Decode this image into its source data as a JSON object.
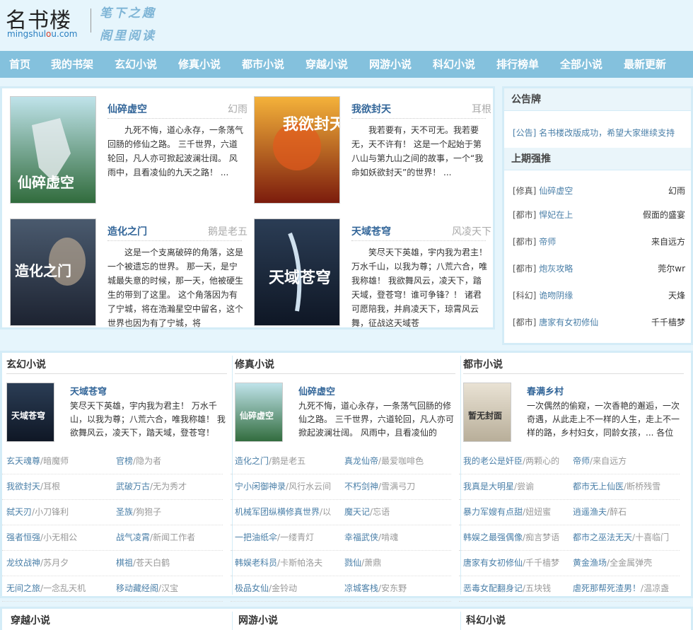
{
  "site": {
    "logo_text": "名书楼",
    "logo_url_prefix": "mingshul",
    "logo_url_mid": "o",
    "logo_url_mid2": "u",
    "logo_url_suffix": ".com",
    "slogan_line1": "笔下之趣",
    "slogan_line2": "阁里阅读"
  },
  "nav": [
    "首页",
    "我的书架",
    "玄幻小说",
    "修真小说",
    "都市小说",
    "穿越小说",
    "网游小说",
    "科幻小说",
    "排行榜单",
    "全部小说",
    "最新更新"
  ],
  "featured": [
    {
      "title": "仙碎虚空",
      "author": "幻雨",
      "desc": "九死不悔，道心永存，一条荡气回肠的修仙之路。 三千世界，六道轮回，凡人亦可掀起波澜壮阔。 风雨中，且看凌仙的九天之路！ ...",
      "cover_label": "仙碎虚空"
    },
    {
      "title": "我欲封天",
      "author": "耳根",
      "desc": "我若要有，天不可无。我若要无，天不许有！ 这是一个起始于第八山与第九山之间的故事，一个“我命如妖欲封天”的世界！ ...",
      "cover_label": "我欲封天"
    },
    {
      "title": "造化之门",
      "author": "鹅是老五",
      "desc": "这是一个支离破碎的角落，这是一个被遗忘的世界。 那一天，是宁城最失意的时候，那一天，他被硬生生的带到了这里。 这个角落因为有了宁城，将在浩瀚星空中留名，这个世界也因为有了宁城，将",
      "cover_label": "造化之门"
    },
    {
      "title": "天域苍穹",
      "author": "风凌天下",
      "desc": "笑尽天下英雄，宇内我为君主！ 万水千山，以我为尊；八荒六合，唯我称雄！ 我欲舞风云，凌天下，踏天域，登苍穹！谁可争锋？！ 诸君可愿陪我，并肩凌天下，琼霄风云舞，征战这天域苍",
      "cover_label": "天域苍穹"
    }
  ],
  "sidebar": {
    "notice_heading": "公告牌",
    "notice_text": "[公告] 名书楼改版成功，希望大家继续支持",
    "rank_heading": "上期强推",
    "rank": [
      {
        "cat": "[修真]",
        "title": "仙碎虚空",
        "author": "幻雨"
      },
      {
        "cat": "[都市]",
        "title": "悍妃在上",
        "author": "假面的盛宴"
      },
      {
        "cat": "[都市]",
        "title": "帝师",
        "author": "来自远方"
      },
      {
        "cat": "[都市]",
        "title": "炮灰攻略",
        "author": "莞尔wr"
      },
      {
        "cat": "[科幻]",
        "title": "诡吻阴缘",
        "author": "天烽"
      },
      {
        "cat": "[都市]",
        "title": "唐家有女初修仙",
        "author": "千千樯梦"
      }
    ]
  },
  "categories": [
    {
      "heading": "玄幻小说",
      "top": {
        "title": "天域苍穹",
        "desc": "笑尽天下英雄，宇内我为君主！ 万水千山，以我为尊；八荒六合，唯我称雄！ 我欲舞风云，凌天下，踏天域，登苍穹！",
        "cover_label": "天域苍穹"
      },
      "items": [
        {
          "title": "玄天魂尊",
          "author": "暗魔师"
        },
        {
          "title": "官榜",
          "author": "隐为者"
        },
        {
          "title": "我欲封天",
          "author": "耳根"
        },
        {
          "title": "武破万古",
          "author": "无为秀才"
        },
        {
          "title": "弑天刃",
          "author": "小刀锋利"
        },
        {
          "title": "圣族",
          "author": "狗狍子"
        },
        {
          "title": "强者恒强",
          "author": "小无相公"
        },
        {
          "title": "战气凌霄",
          "author": "新闻工作者"
        },
        {
          "title": "龙纹战神",
          "author": "苏月夕"
        },
        {
          "title": "棋祖",
          "author": "苍天白鹤"
        },
        {
          "title": "无间之旅",
          "author": "一念乱天机"
        },
        {
          "title": "移动藏经阁",
          "author": "汉宝"
        }
      ]
    },
    {
      "heading": "修真小说",
      "top": {
        "title": "仙碎虚空",
        "desc": "九死不悔，道心永存，一条荡气回肠的修仙之路。 三千世界，六道轮回，凡人亦可掀起波澜壮阔。 风雨中，且看凌仙的",
        "cover_label": "仙碎虚空"
      },
      "items": [
        {
          "title": "造化之门",
          "author": "鹅是老五"
        },
        {
          "title": "真龙仙帝",
          "author": "最爱咖啡色"
        },
        {
          "title": "宁小闲御神录",
          "author": "风行水云间"
        },
        {
          "title": "不朽剑神",
          "author": "雪满弓刀"
        },
        {
          "title": "机械军团纵横修真世界",
          "author": "以"
        },
        {
          "title": "魔天记",
          "author": "忘语"
        },
        {
          "title": "一把油纸伞",
          "author": "一缕青灯"
        },
        {
          "title": "幸福武侠",
          "author": "啃魂"
        },
        {
          "title": "韩娱老科员",
          "author": "卡斯帕洛夫"
        },
        {
          "title": "戮仙",
          "author": "萧鼎"
        },
        {
          "title": "极品女仙",
          "author": "金铃动"
        },
        {
          "title": "凉城客栈",
          "author": "安东野"
        }
      ]
    },
    {
      "heading": "都市小说",
      "top": {
        "title": "春满乡村",
        "desc": "一次偶然的偷窥，一次香艳的邂逅，一次奇遇，从此走上不一样的人生，走上不一样的路，乡村妇女，同龄女孩，... 各位",
        "cover_label": "暂无封面"
      },
      "items": [
        {
          "title": "我的老公是奸臣",
          "author": "两颗心的"
        },
        {
          "title": "帝师",
          "author": "来自远方"
        },
        {
          "title": "我真是大明星",
          "author": "尝谕"
        },
        {
          "title": "都市无上仙医",
          "author": "断桥残雪"
        },
        {
          "title": "暴力军嫂有点甜",
          "author": "妞妞蜜"
        },
        {
          "title": "逍遥渔夫",
          "author": "醉石"
        },
        {
          "title": "韩娱之最强偶像",
          "author": "痴言梦语"
        },
        {
          "title": "都市之巫法无天",
          "author": "十喜临门"
        },
        {
          "title": "唐家有女初修仙",
          "author": "千千樯梦"
        },
        {
          "title": "黄金渔场",
          "author": "全金属弹壳"
        },
        {
          "title": "恶毒女配翻身记",
          "author": "五块钱"
        },
        {
          "title": "虐死那帮死渣男！",
          "author": "温凉盏"
        }
      ]
    }
  ],
  "bottom_headings": [
    "穿越小说",
    "网游小说",
    "科幻小说"
  ],
  "colors": {
    "page_bg": "#e6f5fc",
    "nav_bg": "#84c1dd",
    "link": "#4a7fa8",
    "title": "#336699",
    "border": "#d4ecf7"
  }
}
